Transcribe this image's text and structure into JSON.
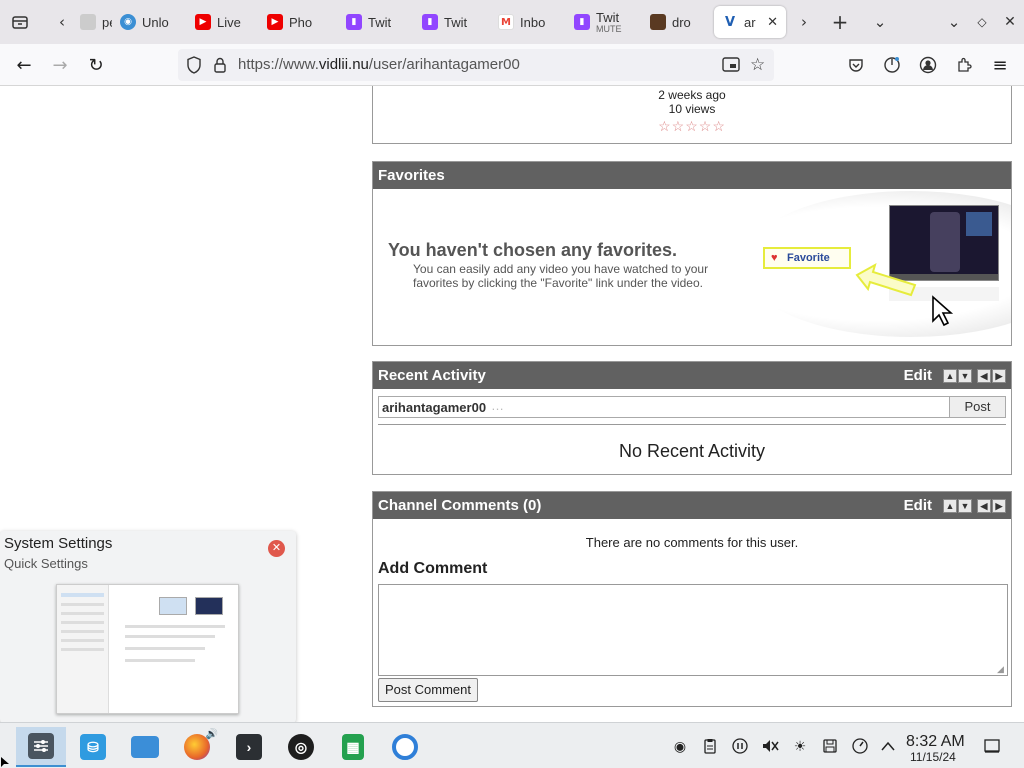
{
  "browser": {
    "tabs": [
      {
        "label": "pe",
        "icon": "page-icon",
        "color": "#888888"
      },
      {
        "label": "Unlo",
        "icon": "chat-bubble-icon",
        "color": "#3b8fd4"
      },
      {
        "label": "Live",
        "icon": "youtube-icon",
        "color": "#ee0000"
      },
      {
        "label": "Pho",
        "icon": "youtube-icon",
        "color": "#ee0000"
      },
      {
        "label": "Twit",
        "icon": "twitch-icon",
        "color": "#9146ff"
      },
      {
        "label": "Twit",
        "icon": "twitch-icon",
        "color": "#9146ff"
      },
      {
        "label": "Inbo",
        "icon": "gmail-icon",
        "color": "#ea4335"
      },
      {
        "label": "Twit",
        "sublabel": "MUTE",
        "icon": "twitch-icon",
        "color": "#9146ff"
      },
      {
        "label": "dro",
        "icon": "game-thumbnail-icon",
        "color": "#5a3a22"
      },
      {
        "label": "ar",
        "icon": "vidlii-icon",
        "color": "#1f5fb3",
        "active": true
      }
    ],
    "url_host": "https://www.",
    "url_domain": "vidlii.nu",
    "url_path": "/user/arihantagamer00"
  },
  "video_item": {
    "age": "2 weeks ago",
    "views": "10 views",
    "stars": "☆☆☆☆☆"
  },
  "favorites": {
    "title": "Favorites",
    "empty_title": "You haven't chosen any favorites.",
    "empty_desc": "You can easily add any video you have watched to your favorites by clicking the \"Favorite\" link under the video.",
    "illustration_button": "Favorite"
  },
  "recent_activity": {
    "title": "Recent Activity",
    "edit_label": "Edit",
    "username": "arihantagamer00",
    "post_label": "Post",
    "empty_text": "No Recent Activity"
  },
  "channel_comments": {
    "title": "Channel Comments (0)",
    "edit_label": "Edit",
    "empty_text": "There are no comments for this user.",
    "add_title": "Add Comment",
    "comment_value": "",
    "submit_label": "Post Comment"
  },
  "popup": {
    "title": "System Settings",
    "subtitle": "Quick Settings"
  },
  "taskbar": {
    "apps": [
      {
        "name": "system-settings",
        "color": "#4a5560",
        "active": true
      },
      {
        "name": "discover",
        "color": "#2f9be0"
      },
      {
        "name": "dolphin",
        "color": "#3b8ed8"
      },
      {
        "name": "firefox",
        "color": "#e8662a"
      },
      {
        "name": "konsole",
        "color": "#2b2f33"
      },
      {
        "name": "obs",
        "color": "#1e1e1e"
      },
      {
        "name": "libreoffice-calc",
        "color": "#24a14f"
      },
      {
        "name": "chromium",
        "color": "#2f7fd8"
      }
    ],
    "time": "8:32 AM",
    "date": "11/15/24"
  }
}
